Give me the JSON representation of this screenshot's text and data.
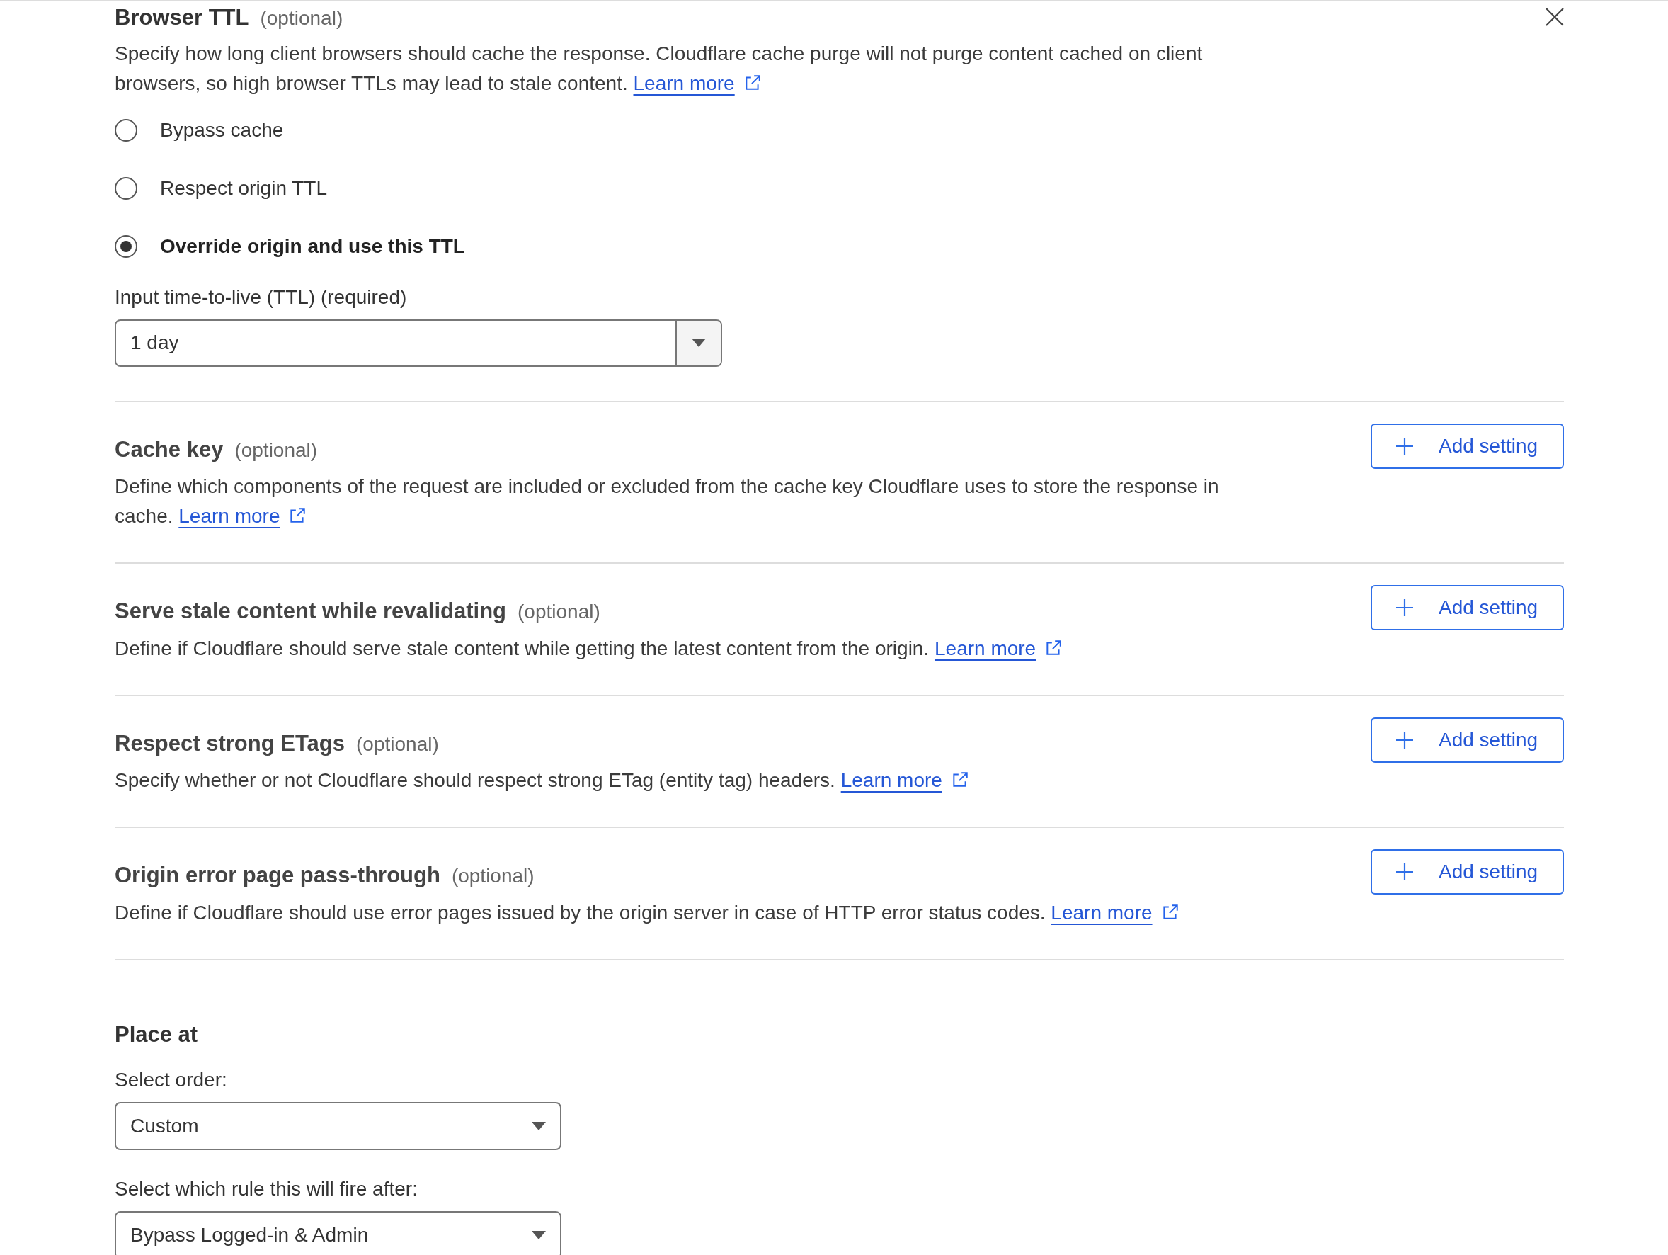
{
  "browser_ttl": {
    "title": "Browser TTL",
    "optional": "(optional)",
    "description": "Specify how long client browsers should cache the response. Cloudflare cache purge will not purge content cached on client browsers, so high browser TTLs may lead to stale content.",
    "link": "Learn more",
    "options": [
      {
        "label": "Bypass cache",
        "selected": false
      },
      {
        "label": "Respect origin TTL",
        "selected": false
      },
      {
        "label": "Override origin and use this TTL",
        "selected": true
      }
    ],
    "ttl_label": "Input time-to-live (TTL) (required)",
    "ttl_value": "1 day"
  },
  "settings": [
    {
      "title": "Cache key",
      "optional": "(optional)",
      "description": "Define which components of the request are included or excluded from the cache key Cloudflare uses to store the response in cache.",
      "link": "Learn more",
      "button": "Add setting"
    },
    {
      "title": "Serve stale content while revalidating",
      "optional": "(optional)",
      "description": "Define if Cloudflare should serve stale content while getting the latest content from the origin.",
      "link": "Learn more",
      "button": "Add setting"
    },
    {
      "title": "Respect strong ETags",
      "optional": "(optional)",
      "description": "Specify whether or not Cloudflare should respect strong ETag (entity tag) headers.",
      "link": "Learn more",
      "button": "Add setting"
    },
    {
      "title": "Origin error page pass-through",
      "optional": "(optional)",
      "description": "Define if Cloudflare should use error pages issued by the origin server in case of HTTP error status codes.",
      "link": "Learn more",
      "button": "Add setting"
    }
  ],
  "place_at": {
    "title": "Place at",
    "order_label": "Select order:",
    "order_value": "Custom",
    "after_label": "Select which rule this will fire after:",
    "after_value": "Bypass Logged-in & Admin"
  }
}
